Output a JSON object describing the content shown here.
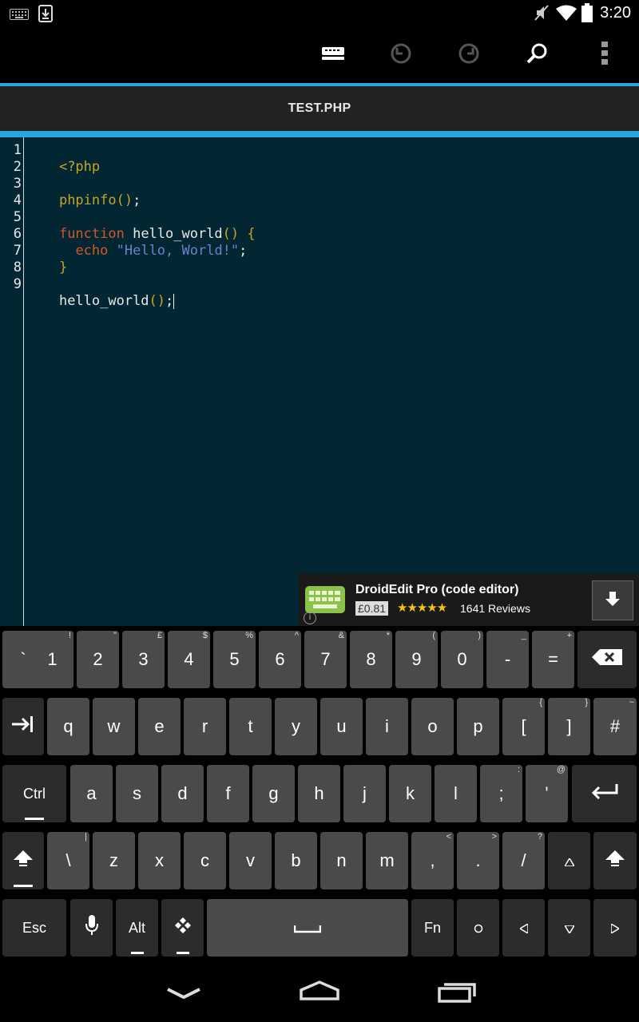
{
  "status_bar": {
    "time": "3:20",
    "icons": [
      "keyboard-icon",
      "download-icon",
      "mute-icon",
      "wifi-icon",
      "battery-icon"
    ]
  },
  "action_bar": {
    "buttons": [
      "keyboard-hide-icon",
      "undo-icon",
      "redo-icon",
      "search-icon",
      "overflow-menu-icon"
    ]
  },
  "tab": {
    "title": "TEST.PHP"
  },
  "editor": {
    "line_numbers": [
      "1",
      "2",
      "3",
      "4",
      "5",
      "6",
      "7",
      "8",
      "9"
    ],
    "code": {
      "l1_tag": "<?php",
      "l3_fn": "phpinfo",
      "l3_parens": "()",
      "l3_semi": ";",
      "l5_kw": "function",
      "l5_name": " hello_world",
      "l5_parens": "()",
      "l5_brace": " {",
      "l6_indent": "  ",
      "l6_kw": "echo",
      "l6_str": " \"Hello, World!\"",
      "l6_semi": ";",
      "l7_brace": "}",
      "l9_name": "hello_world",
      "l9_parens": "()",
      "l9_semi": ";"
    }
  },
  "ad": {
    "title": "DroidEdit Pro (code editor)",
    "price": "£0.81",
    "stars": "★★★★★",
    "rating": 4.5,
    "reviews": "1641 Reviews"
  },
  "keyboard": {
    "row1": [
      {
        "label": "`",
        "alt": ""
      },
      {
        "label": "1",
        "alt": "!"
      },
      {
        "label": "2",
        "alt": "\""
      },
      {
        "label": "3",
        "alt": "£"
      },
      {
        "label": "4",
        "alt": "$"
      },
      {
        "label": "5",
        "alt": "%"
      },
      {
        "label": "6",
        "alt": "^"
      },
      {
        "label": "7",
        "alt": "&"
      },
      {
        "label": "8",
        "alt": "*"
      },
      {
        "label": "9",
        "alt": "("
      },
      {
        "label": "0",
        "alt": ")"
      },
      {
        "label": "-",
        "alt": "_"
      },
      {
        "label": "=",
        "alt": "+"
      }
    ],
    "row2": [
      {
        "label": "q"
      },
      {
        "label": "w"
      },
      {
        "label": "e"
      },
      {
        "label": "r"
      },
      {
        "label": "t"
      },
      {
        "label": "y"
      },
      {
        "label": "u"
      },
      {
        "label": "i"
      },
      {
        "label": "o"
      },
      {
        "label": "p"
      },
      {
        "label": "[",
        "alt": "{"
      },
      {
        "label": "]",
        "alt": "}"
      },
      {
        "label": "#",
        "alt": "~"
      }
    ],
    "row3": [
      {
        "label": "a"
      },
      {
        "label": "s"
      },
      {
        "label": "d"
      },
      {
        "label": "f"
      },
      {
        "label": "g"
      },
      {
        "label": "h"
      },
      {
        "label": "j"
      },
      {
        "label": "k"
      },
      {
        "label": "l"
      },
      {
        "label": ";",
        "alt": ":"
      },
      {
        "label": "'",
        "alt": "@"
      }
    ],
    "row4": [
      {
        "label": "\\",
        "alt": "|"
      },
      {
        "label": "z"
      },
      {
        "label": "x"
      },
      {
        "label": "c"
      },
      {
        "label": "v"
      },
      {
        "label": "b"
      },
      {
        "label": "n"
      },
      {
        "label": "m"
      },
      {
        "label": ",",
        "alt": "<"
      },
      {
        "label": ".",
        "alt": ">"
      },
      {
        "label": "/",
        "alt": "?"
      }
    ],
    "ctrl": "Ctrl",
    "esc": "Esc",
    "alt_key": "Alt",
    "fn": "Fn"
  },
  "nav_bar": {
    "icons": [
      "back-icon",
      "home-icon",
      "recents-icon"
    ]
  }
}
